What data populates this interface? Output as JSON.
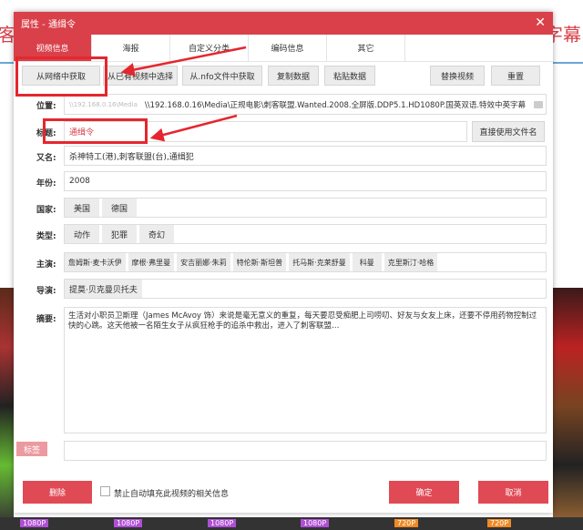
{
  "background": {
    "left_title": "客",
    "right_title": "字幕",
    "badges": [
      "1080P",
      "1080P",
      "1080P",
      "1080P",
      "720P",
      "720P"
    ]
  },
  "dialog": {
    "title": "属性 - 通缉令",
    "close_label": "✕",
    "tabs": [
      "视频信息",
      "海报",
      "自定义分类",
      "编码信息",
      "其它"
    ],
    "toolbar": {
      "fetch_online": "从网络中获取",
      "select_existing": "从已有视频中选择",
      "fetch_nfo": "从.nfo文件中获取",
      "copy": "复制数据",
      "paste": "粘贴数据",
      "replace": "替换视频",
      "reset": "重置"
    },
    "location": {
      "label": "位置:",
      "prefix": "\\\\192.168.0.16\\Media",
      "value": "\\\\192.168.0.16\\Media\\正规电影\\刺客联盟.Wanted.2008.全屏版.DDP5.1.HD1080P.国英双语.特效中英字幕"
    },
    "title_field": {
      "label": "标题:",
      "value": "通缉令",
      "use_filename": "直接使用文件名"
    },
    "alias": {
      "label": "又名:",
      "value": "杀神特工(港),刺客联盟(台),通缉犯"
    },
    "year": {
      "label": "年份:",
      "value": "2008"
    },
    "country": {
      "label": "国家:",
      "items": [
        "美国",
        "德国"
      ]
    },
    "genre": {
      "label": "类型:",
      "items": [
        "动作",
        "犯罪",
        "奇幻"
      ]
    },
    "cast": {
      "label": "主演:",
      "items": [
        "詹姆斯·麦卡沃伊",
        "摩根·弗里曼",
        "安吉丽娜·朱莉",
        "特伦斯·斯坦普",
        "托马斯·克莱舒曼",
        "科曼",
        "克里斯汀·哈格"
      ]
    },
    "director": {
      "label": "导演:",
      "items": [
        "提莫·贝克曼贝托夫"
      ]
    },
    "summary": {
      "label": "摘要:",
      "value": "生活对小职员卫斯理（James McAvoy 饰）来说是毫无意义的重复，每天要忍受痴肥上司唠叨、好友与女友上床，还要不停用药物控制过快的心跳。这天他被一名陌生女子从疯狂枪手的追杀中救出，进入了刺客联盟…"
    },
    "tags": {
      "label": "标签",
      "value": ""
    },
    "footer": {
      "delete": "删除",
      "disable_autofill": "禁止自动填充此视频的相关信息",
      "ok": "确定",
      "cancel": "取消"
    }
  },
  "colors": {
    "accent": "#d9404a",
    "annotation": "#e5262e"
  }
}
